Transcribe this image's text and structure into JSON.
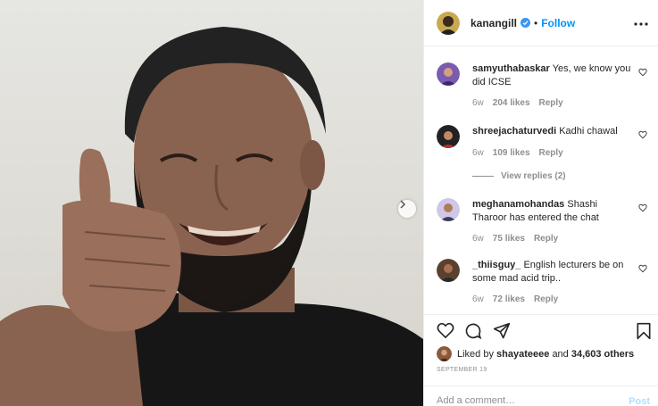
{
  "post": {
    "author": "kanangill",
    "separator": "•",
    "follow_label": "Follow",
    "next_icon": "chevron-right-icon",
    "more_icon": "more-horizontal-icon"
  },
  "comments": [
    {
      "username": "samyuthabaskar",
      "text": "Yes, we know you did ICSE",
      "time": "6w",
      "likes": "204 likes",
      "reply": "Reply"
    },
    {
      "username": "shreejachaturvedi",
      "text": "Kadhi chawal",
      "time": "6w",
      "likes": "109 likes",
      "reply": "Reply"
    },
    {
      "username": "meghanamohandas",
      "text": "Shashi Tharoor has entered the chat",
      "time": "6w",
      "likes": "75 likes",
      "reply": "Reply"
    },
    {
      "username": "_thiisguy_",
      "text": "English lecturers be on some mad acid trip..",
      "time": "6w",
      "likes": "72 likes",
      "reply": "Reply"
    }
  ],
  "view_replies": "View replies (2)",
  "likes": {
    "prefix": "Liked by",
    "user": "shayateeee",
    "and": "and",
    "others": "34,603 others"
  },
  "date": "SEPTEMBER 19",
  "add_comment": {
    "placeholder": "Add a comment…",
    "post_label": "Post"
  },
  "icons": [
    "heart-icon",
    "comment-icon",
    "share-icon",
    "bookmark-icon",
    "verified-badge-icon"
  ],
  "colors": {
    "accent": "#0095f6",
    "text": "#262626",
    "muted": "#8e8e8e",
    "post_disabled": "#b2dffc"
  }
}
